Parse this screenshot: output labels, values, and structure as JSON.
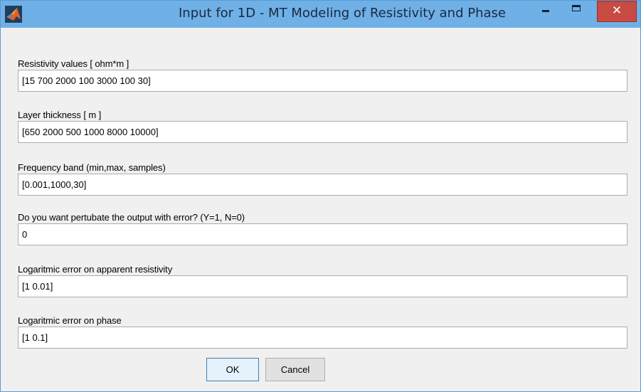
{
  "window": {
    "title": "Input for 1D - MT Modeling of Resistivity and Phase",
    "icon": "matlab-logo-icon",
    "controls": {
      "minimize": "minimize-icon",
      "maximize": "maximize-icon",
      "close": "✕"
    }
  },
  "fields": [
    {
      "label": "Resistivity values [ ohm*m ]",
      "value": "[15 700 2000 100 3000 100 30]"
    },
    {
      "label": "Layer thickness [ m ]",
      "value": "[650 2000 500 1000 8000 10000]"
    },
    {
      "label": "Frequency band (min,max, samples)",
      "value": "[0.001,1000,30]"
    },
    {
      "label": "Do you want pertubate the output with error? (Y=1, N=0)",
      "value": "0"
    },
    {
      "label": "Logaritmic error on apparent resistivity",
      "value": "[1 0.01]"
    },
    {
      "label": "Logaritmic error on phase",
      "value": "[1 0.1]"
    }
  ],
  "buttons": {
    "ok": "OK",
    "cancel": "Cancel"
  },
  "colors": {
    "titlebar": "#6fb0e6",
    "close_button": "#c74a43",
    "dialog_background": "#f0f0f0",
    "default_button": "#e5f1fb"
  }
}
